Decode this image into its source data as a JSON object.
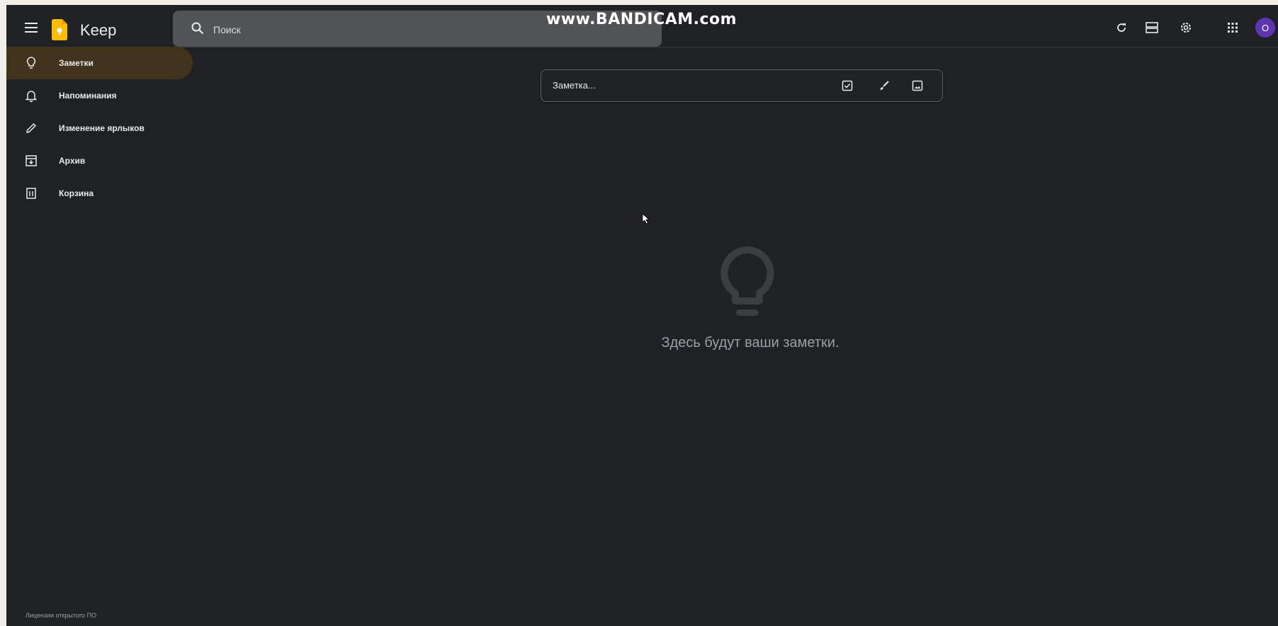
{
  "app": {
    "name": "Keep"
  },
  "search": {
    "placeholder": "Поиск"
  },
  "watermark": "www.BANDICAM.com",
  "header": {
    "avatar_initial": "O"
  },
  "sidebar": {
    "items": [
      {
        "label": "Заметки",
        "icon": "lightbulb-icon",
        "active": true
      },
      {
        "label": "Напоминания",
        "icon": "bell-icon",
        "active": false
      },
      {
        "label": "Изменение ярлыков",
        "icon": "pencil-icon",
        "active": false
      },
      {
        "label": "Архив",
        "icon": "archive-icon",
        "active": false
      },
      {
        "label": "Корзина",
        "icon": "trash-icon",
        "active": false
      }
    ],
    "footer_link": "Лицензии открытого ПО"
  },
  "composer": {
    "placeholder": "Заметка..."
  },
  "empty_state": {
    "text": "Здесь будут ваши заметки."
  },
  "colors": {
    "background": "#202124",
    "active_nav": "#41331c",
    "avatar": "#5e35b1",
    "logo": "#fbbc04"
  }
}
